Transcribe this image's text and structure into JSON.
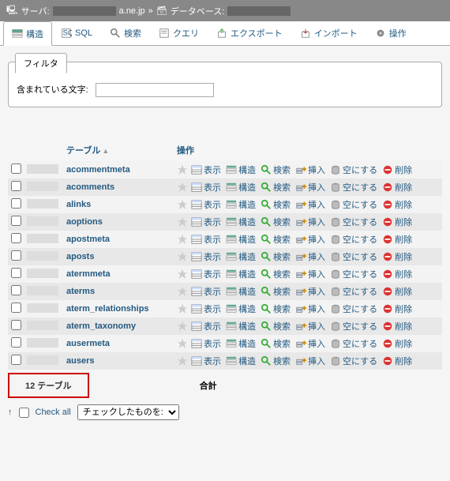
{
  "breadcrumb": {
    "server_label": "サーバ:",
    "server_suffix": "a.ne.jp",
    "db_label": "データベース:"
  },
  "tabs": [
    {
      "label": "構造",
      "icon": "structure",
      "active": true
    },
    {
      "label": "SQL",
      "icon": "sql"
    },
    {
      "label": "検索",
      "icon": "search"
    },
    {
      "label": "クエリ",
      "icon": "query"
    },
    {
      "label": "エクスポート",
      "icon": "export"
    },
    {
      "label": "インポート",
      "icon": "import"
    },
    {
      "label": "操作",
      "icon": "operations"
    }
  ],
  "filter": {
    "tab_label": "フィルタ",
    "input_label": "含まれている文字:",
    "value": ""
  },
  "table_header": {
    "col_table": "テーブル",
    "col_ops": "操作"
  },
  "actions": {
    "browse": "表示",
    "structure": "構造",
    "search": "検索",
    "insert": "挿入",
    "empty": "空にする",
    "drop": "削除"
  },
  "rows": [
    {
      "name": "acommentmeta"
    },
    {
      "name": "acomments"
    },
    {
      "name": "alinks"
    },
    {
      "name": "aoptions"
    },
    {
      "name": "apostmeta"
    },
    {
      "name": "aposts"
    },
    {
      "name": "atermmeta"
    },
    {
      "name": "aterms"
    },
    {
      "name": "aterm_relationships"
    },
    {
      "name": "aterm_taxonomy"
    },
    {
      "name": "ausermeta"
    },
    {
      "name": "ausers"
    }
  ],
  "summary": {
    "count": "12 テーブル",
    "total": "合計"
  },
  "checkall": {
    "label": "Check all",
    "select_label": "チェックしたものを:"
  }
}
